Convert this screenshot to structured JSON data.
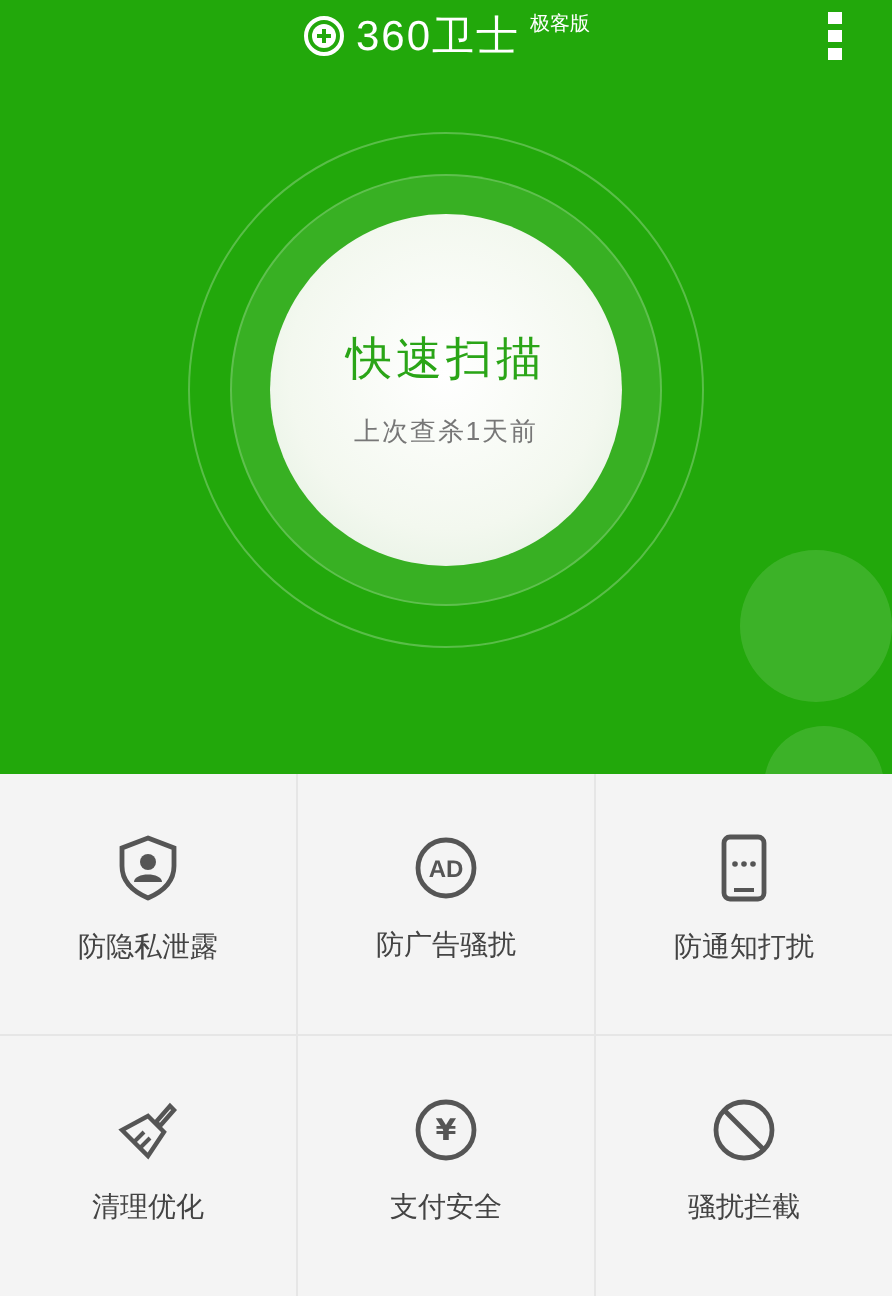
{
  "header": {
    "title": "360卫士",
    "edition": "极客版"
  },
  "scan": {
    "button": "快速扫描",
    "last_scan": "上次查杀1天前"
  },
  "features": [
    {
      "kind": "shield",
      "label": "防隐私泄露"
    },
    {
      "kind": "ad",
      "label": "防广告骚扰",
      "icon_text": "AD"
    },
    {
      "kind": "phone",
      "label": "防通知打扰"
    },
    {
      "kind": "broom",
      "label": "清理优化"
    },
    {
      "kind": "yen",
      "label": "支付安全",
      "icon_text": "¥"
    },
    {
      "kind": "block",
      "label": "骚扰拦截"
    }
  ]
}
